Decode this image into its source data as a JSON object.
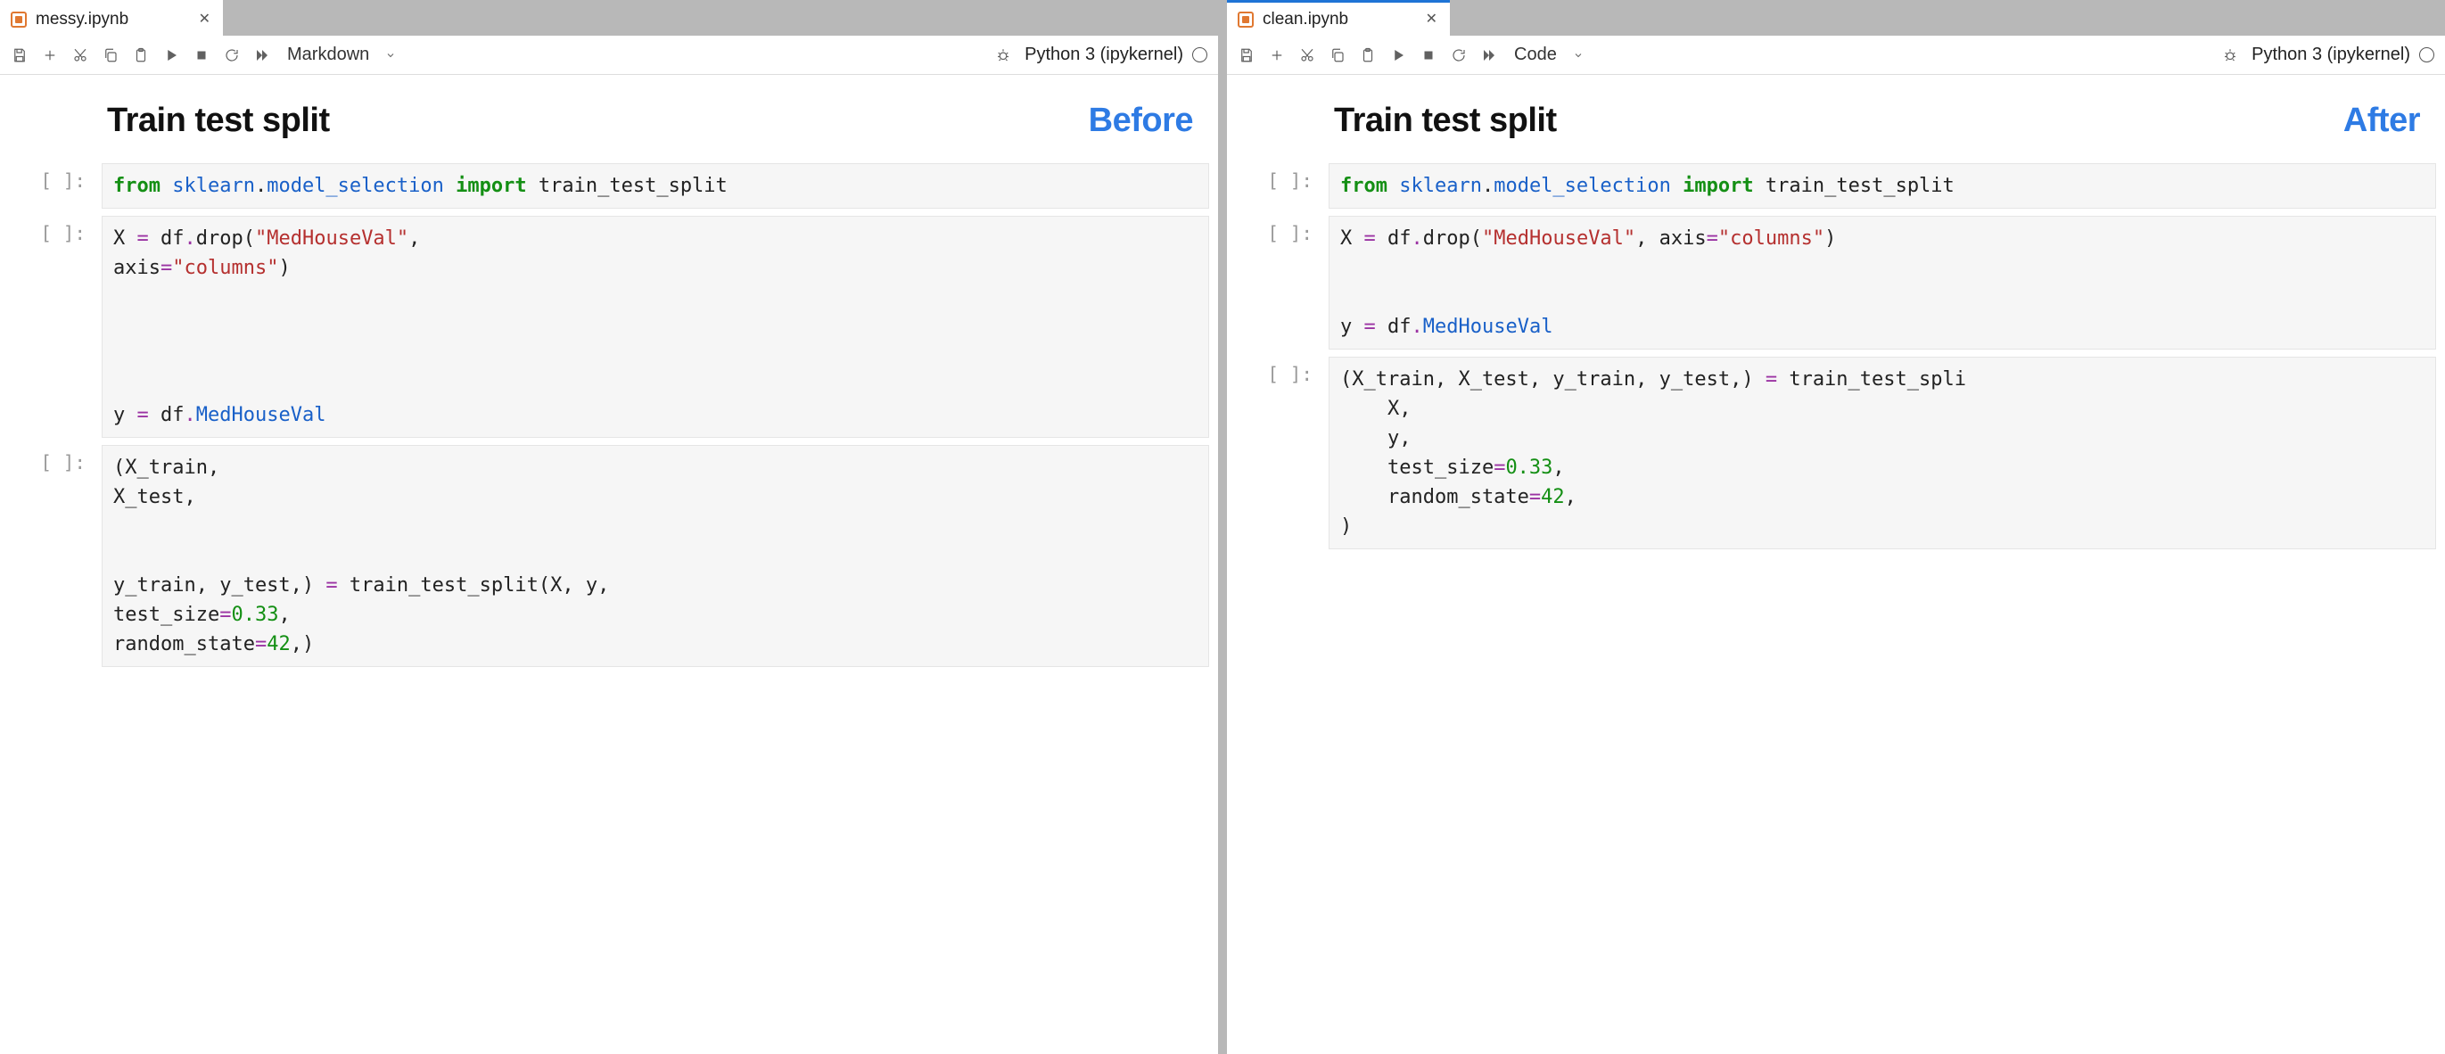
{
  "left": {
    "tab_title": "messy.ipynb",
    "cell_type_selector": "Markdown",
    "kernel": "Python 3 (ipykernel)",
    "heading": "Train test split",
    "badge": "Before",
    "prompt": "[ ]:",
    "code1": {
      "from": "from",
      "mod1": "sklearn",
      "dot1": ".",
      "mod2": "model_selection",
      "imp": "import",
      "name": "train_test_split"
    },
    "code2": {
      "l1a": "X ",
      "l1eq": "=",
      "l1b": " df",
      "l1dot": ".",
      "l1c": "drop(",
      "l1str": "\"MedHouseVal\"",
      "l1d": ",",
      "l2a": "axis",
      "l2eq": "=",
      "l2str": "\"columns\"",
      "l2b": ")",
      "blank": "",
      "l3a": "y ",
      "l3eq": "=",
      "l3b": " df",
      "l3dot": ".",
      "l3attr": "MedHouseVal"
    },
    "code3": {
      "l1": "(X_train,",
      "l2": "X_test,",
      "blank": "",
      "l3a": "y_train, y_test,) ",
      "l3eq": "=",
      "l3b": " train_test_split(X, y,",
      "l4a": "test_size",
      "l4eq": "=",
      "l4num": "0.33",
      "l4b": ",",
      "l5a": "random_state",
      "l5eq": "=",
      "l5num": "42",
      "l5b": ",)"
    }
  },
  "right": {
    "tab_title": "clean.ipynb",
    "cell_type_selector": "Code",
    "kernel": "Python 3 (ipykernel)",
    "heading": "Train test split",
    "badge": "After",
    "prompt": "[ ]:",
    "code1": {
      "from": "from",
      "mod1": "sklearn",
      "dot1": ".",
      "mod2": "model_selection",
      "imp": "import",
      "name": "train_test_split"
    },
    "code2": {
      "l1a": "X ",
      "l1eq": "=",
      "l1b": " df",
      "l1dot": ".",
      "l1c": "drop(",
      "l1str": "\"MedHouseVal\"",
      "l1d": ", axis",
      "l1eq2": "=",
      "l1str2": "\"columns\"",
      "l1e": ")",
      "blank": "",
      "l3a": "y ",
      "l3eq": "=",
      "l3b": " df",
      "l3dot": ".",
      "l3attr": "MedHouseVal"
    },
    "code3": {
      "l1a": "(X_train, X_test, y_train, y_test,) ",
      "l1eq": "=",
      "l1b": " train_test_spli",
      "l2": "    X,",
      "l3": "    y,",
      "l4a": "    test_size",
      "l4eq": "=",
      "l4num": "0.33",
      "l4b": ",",
      "l5a": "    random_state",
      "l5eq": "=",
      "l5num": "42",
      "l5b": ",",
      "l6": ")"
    }
  }
}
